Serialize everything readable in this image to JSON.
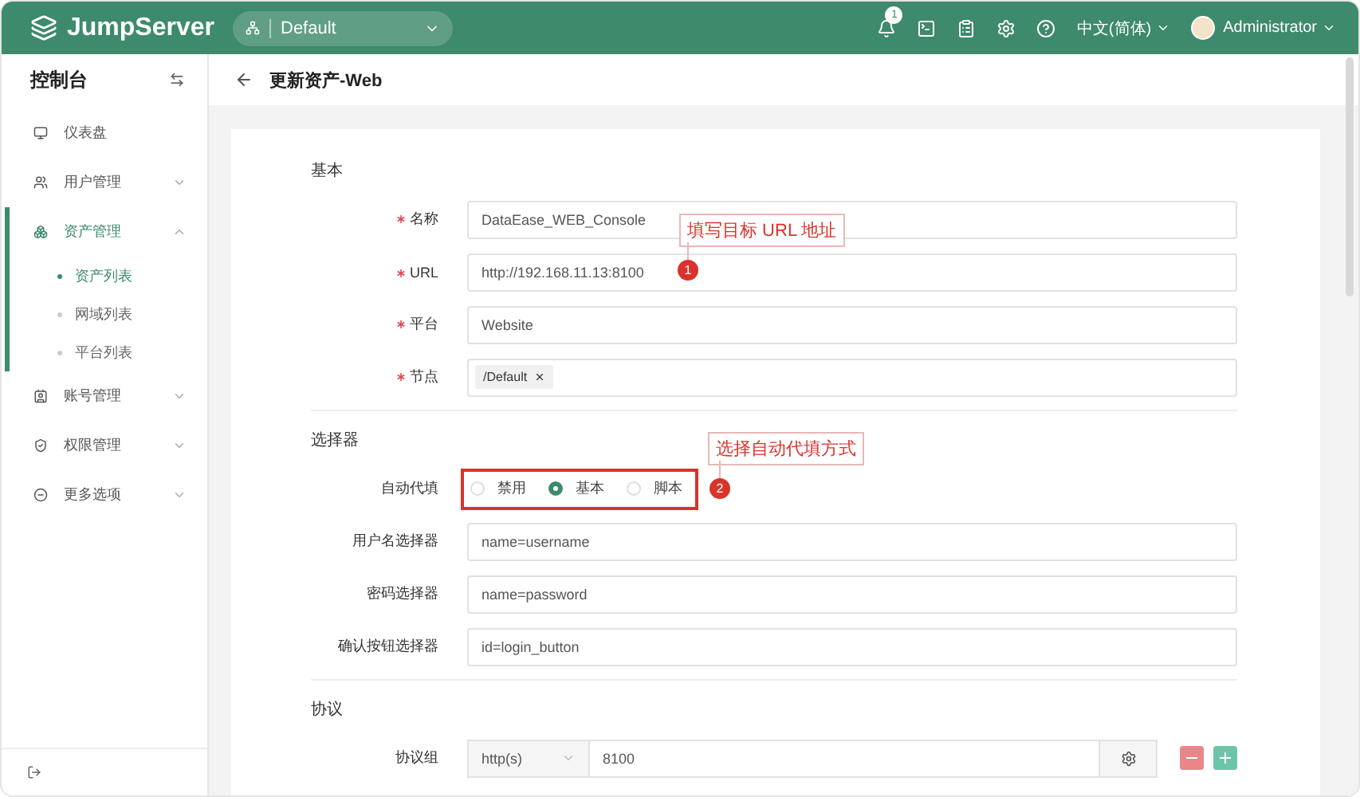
{
  "header": {
    "brand": "JumpServer",
    "org": "Default",
    "notifications": "1",
    "language": "中文(简体)",
    "user": "Administrator"
  },
  "sidebar": {
    "title": "控制台",
    "items": [
      {
        "label": "仪表盘",
        "selected": false
      },
      {
        "label": "用户管理",
        "selected": false,
        "expanded": false
      },
      {
        "label": "资产管理",
        "selected": true,
        "expanded": true,
        "children": [
          {
            "label": "资产列表",
            "selected": true
          },
          {
            "label": "网域列表",
            "selected": false
          },
          {
            "label": "平台列表",
            "selected": false
          }
        ]
      },
      {
        "label": "账号管理",
        "selected": false,
        "expanded": false
      },
      {
        "label": "权限管理",
        "selected": false,
        "expanded": false
      },
      {
        "label": "更多选项",
        "selected": false,
        "expanded": false
      }
    ]
  },
  "page": {
    "title": "更新资产-Web"
  },
  "sections": [
    {
      "title": "基本",
      "fields": [
        {
          "kind": "text",
          "label": "名称",
          "required": true,
          "value": "DataEase_WEB_Console"
        },
        {
          "kind": "text",
          "label": "URL",
          "required": true,
          "value": "http://192.168.11.13:8100"
        },
        {
          "kind": "text",
          "label": "平台",
          "required": true,
          "value": "Website"
        },
        {
          "kind": "tags",
          "label": "节点",
          "required": true,
          "tags": [
            "/Default"
          ]
        }
      ]
    },
    {
      "title": "选择器",
      "fields": [
        {
          "kind": "radio",
          "label": "自动代填",
          "required": false,
          "highlighted": true,
          "options": [
            {
              "label": "禁用",
              "selected": false
            },
            {
              "label": "基本",
              "selected": true
            },
            {
              "label": "脚本",
              "selected": false
            }
          ]
        },
        {
          "kind": "text",
          "label": "用户名选择器",
          "required": false,
          "value": "name=username"
        },
        {
          "kind": "text",
          "label": "密码选择器",
          "required": false,
          "value": "name=password"
        },
        {
          "kind": "text",
          "label": "确认按钮选择器",
          "required": false,
          "value": "id=login_button"
        }
      ]
    },
    {
      "title": "协议",
      "fields": [
        {
          "kind": "protocol",
          "label": "协议组",
          "required": false,
          "protocol": "http(s)",
          "port": "8100"
        }
      ]
    }
  ],
  "annotations": [
    {
      "number": "1",
      "text": "填写目标 URL 地址"
    },
    {
      "number": "2",
      "text": "选择自动代填方式"
    }
  ]
}
